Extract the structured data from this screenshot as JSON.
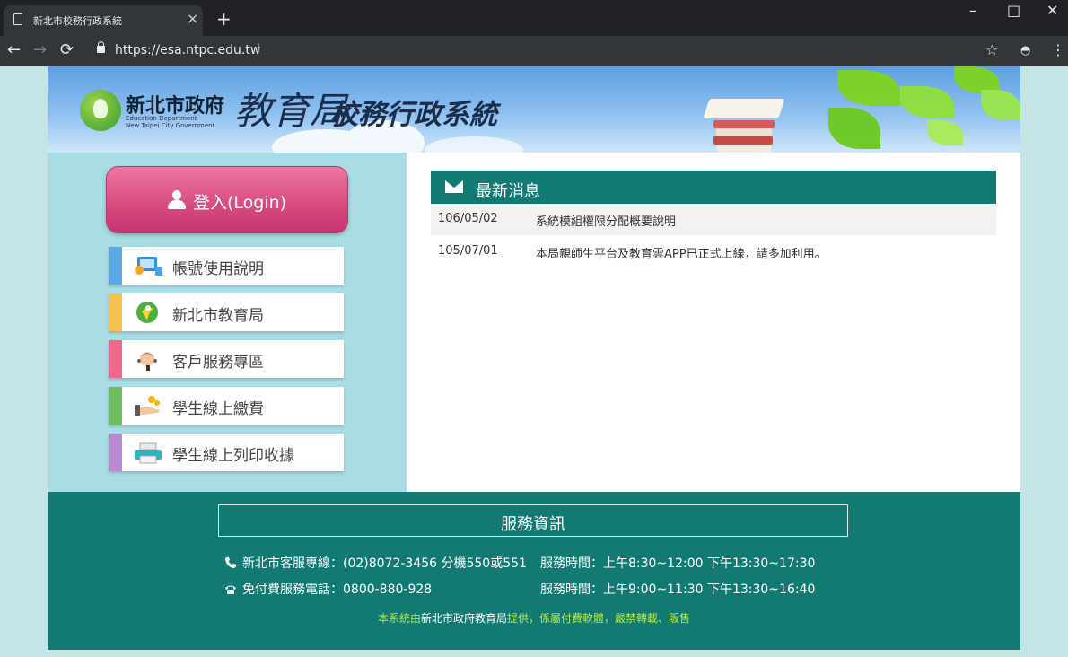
{
  "browser": {
    "tab_title": "新北市校務行政系統",
    "tab_close": "×",
    "new_tab": "+",
    "url": "https://esa.ntpc.edu.tw",
    "min": "–",
    "max": "□",
    "close": "✕"
  },
  "banner": {
    "org": "新北市政府",
    "org_en_line1": "Education Department",
    "org_en_line2": "New Taipei City Government",
    "bureau": "教育局",
    "system": "校務行政系統"
  },
  "sidebar": {
    "login_label": "登入(Login)",
    "items": [
      {
        "label": "帳號使用說明",
        "color": "#5aa9e6",
        "icon": "account-help-icon"
      },
      {
        "label": "新北市教育局",
        "color": "#f6c04e",
        "icon": "education-bureau-logo-icon"
      },
      {
        "label": "客戶服務專區",
        "color": "#f0688c",
        "icon": "customer-service-icon"
      },
      {
        "label": "學生線上繳費",
        "color": "#6cbf5c",
        "icon": "payment-icon"
      },
      {
        "label": "學生線上列印收據",
        "color": "#b98ad0",
        "icon": "printer-icon"
      }
    ]
  },
  "news": {
    "title": "最新消息",
    "items": [
      {
        "date": "106/05/02",
        "text": "系統模組權限分配概要說明"
      },
      {
        "date": "105/07/01",
        "text": "本局親師生平台及教育雲APP已正式上線，請多加利用。"
      }
    ]
  },
  "footer": {
    "title": "服務資訊",
    "hotline": "新北市客服專線：(02)8072-3456 分機550或551",
    "hotline_hours": "服務時間：上午8:30~12:00 下午13:30~17:30",
    "tollfree": "免付費服務電話：0800-880-928",
    "tollfree_hours": "服務時間：上午9:00~11:30 下午13:30~16:40",
    "credit_prefix": "本系統由",
    "credit_org": "新北市政府教育局",
    "credit_suffix": "提供，係屬付費軟體，嚴禁轉載、販售"
  }
}
